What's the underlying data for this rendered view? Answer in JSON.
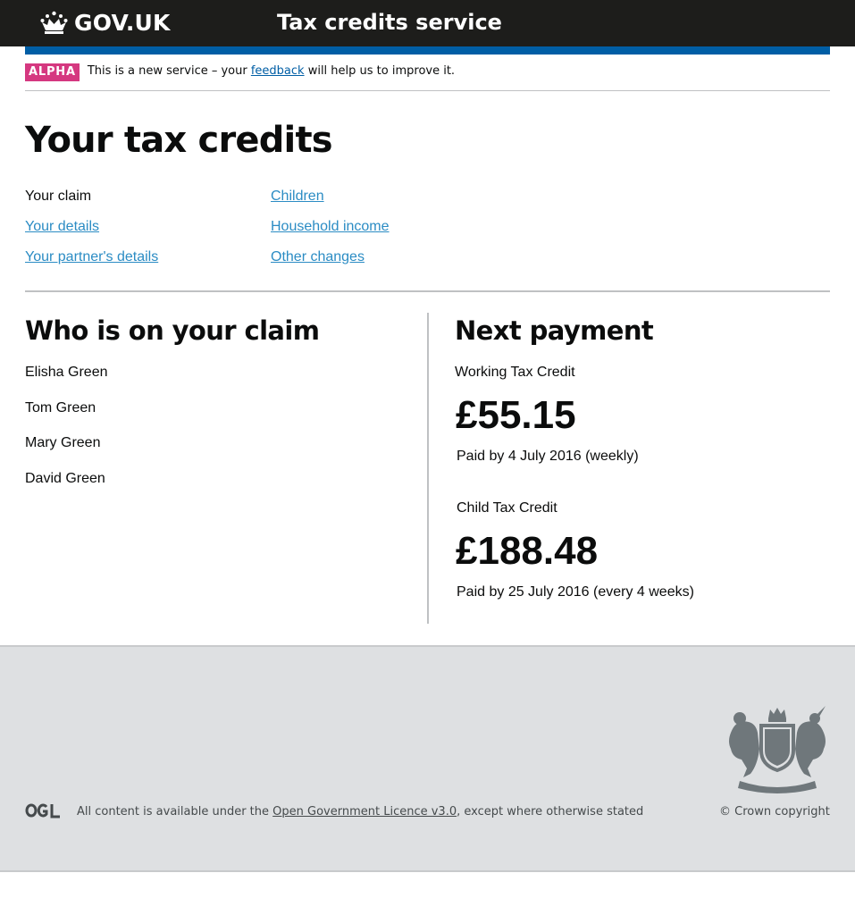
{
  "header": {
    "logo_text": "GOV.UK",
    "logo_icon": "crown-icon",
    "service_name": "Tax credits service",
    "background_color": "#1d1d1b",
    "accent_color": "#005ea5"
  },
  "phase_banner": {
    "tag": "ALPHA",
    "tag_color": "#d53880",
    "text_before": "This is a new service – your ",
    "link_text": "feedback",
    "text_after": " will help us to improve it."
  },
  "page": {
    "title": "Your tax credits"
  },
  "subnav": {
    "items": [
      {
        "label": "Your claim",
        "current": true
      },
      {
        "label": "Your details",
        "current": false
      },
      {
        "label": "Your partner's details",
        "current": false
      },
      {
        "label": "Children",
        "current": false
      },
      {
        "label": "Household income",
        "current": false
      },
      {
        "label": "Other changes",
        "current": false
      }
    ]
  },
  "claim": {
    "heading": "Who is on your claim",
    "people": [
      "Elisha Green",
      "Tom Green",
      "Mary Green",
      "David Green"
    ]
  },
  "next_payment": {
    "heading": "Next payment",
    "credits": [
      {
        "label": "Working Tax Credit",
        "amount": "£55.15",
        "paid_by": "Paid by 4 July 2016 (weekly)"
      },
      {
        "label": "Child Tax Credit",
        "amount": "£188.48",
        "paid_by": "Paid by 25 July 2016 (every 4 weeks)"
      }
    ]
  },
  "footer": {
    "ogl_icon": "ogl-logo-icon",
    "licence_before": "All content is available under the ",
    "licence_link": "Open Government Licence v3.0",
    "licence_after": ", except where otherwise stated",
    "crest_icon": "royal-coat-of-arms-icon",
    "copyright": "© Crown copyright",
    "background_color": "#dee0e2"
  }
}
